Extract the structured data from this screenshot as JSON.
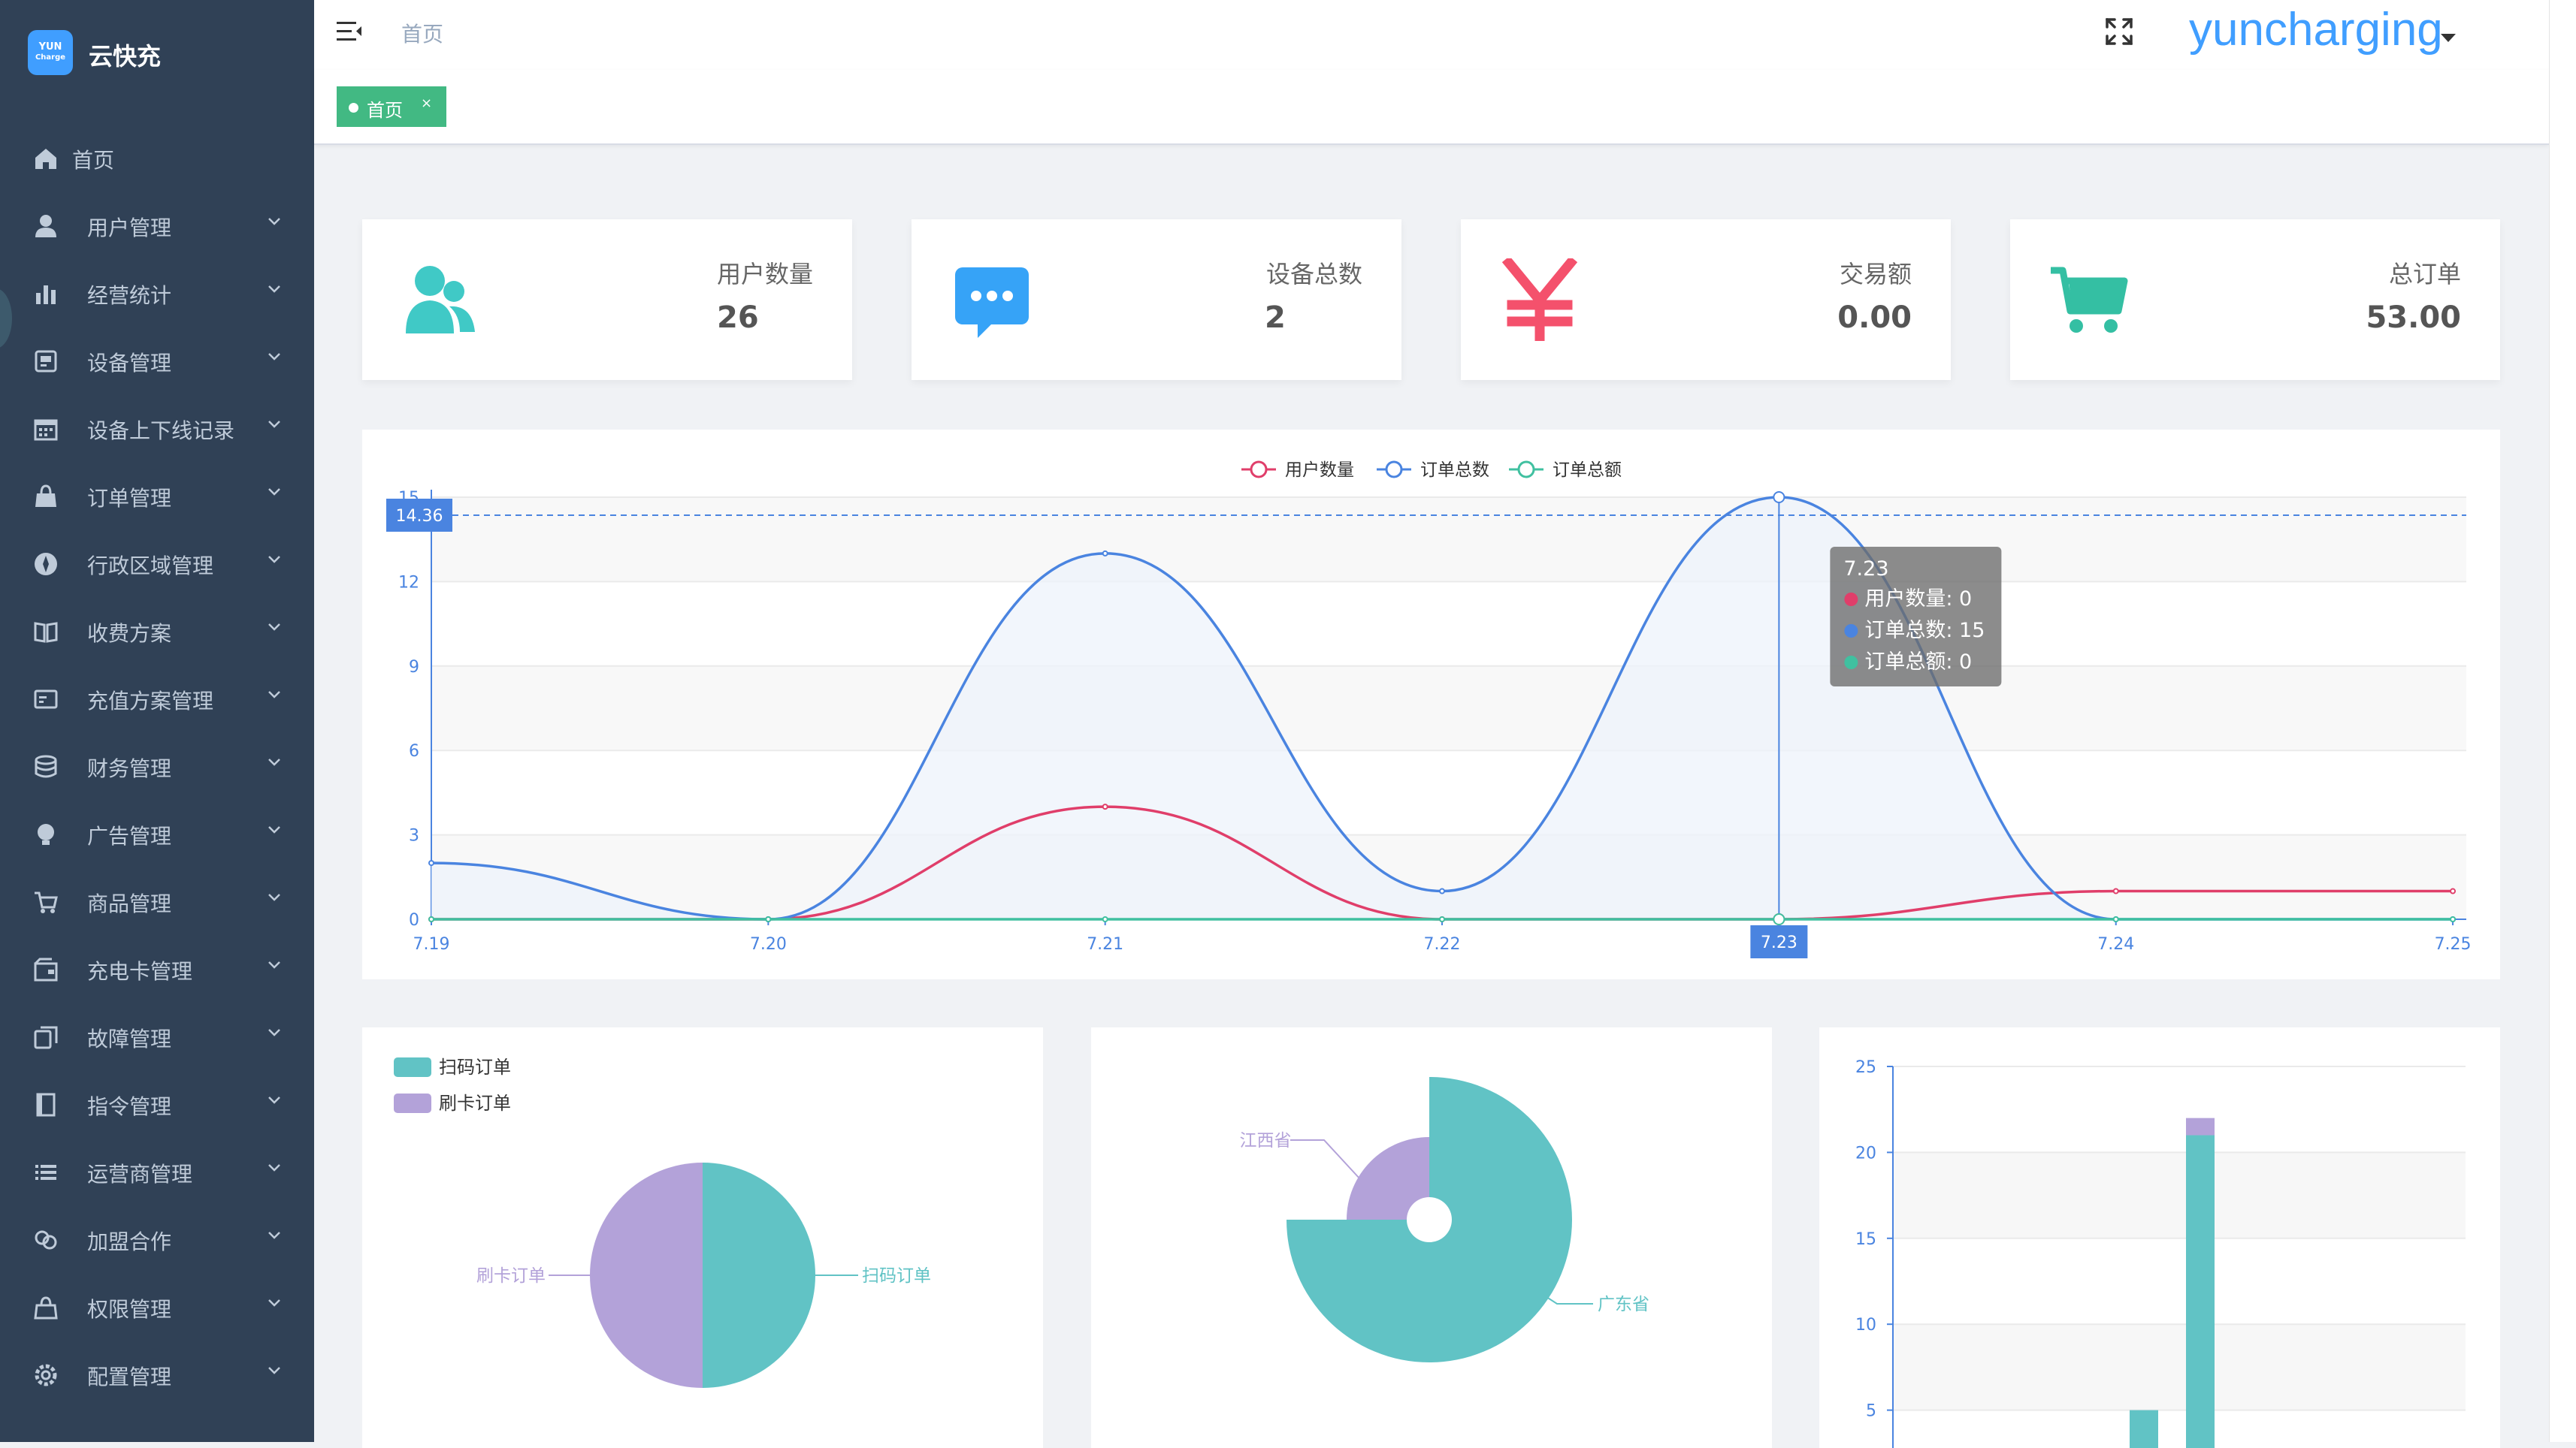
{
  "app": {
    "logo_line1": "YUN",
    "logo_line2": "Charge",
    "title": "云快充"
  },
  "sidebar": {
    "items": [
      {
        "label": "首页",
        "icon": "home-icon"
      },
      {
        "label": "用户管理",
        "icon": "user-icon"
      },
      {
        "label": "经营统计",
        "icon": "bar-chart-icon"
      },
      {
        "label": "设备管理",
        "icon": "device-icon"
      },
      {
        "label": "设备上下线记录",
        "icon": "calendar-icon"
      },
      {
        "label": "订单管理",
        "icon": "shopping-bag-icon"
      },
      {
        "label": "行政区域管理",
        "icon": "compass-icon"
      },
      {
        "label": "收费方案",
        "icon": "book-icon"
      },
      {
        "label": "充值方案管理",
        "icon": "card-icon"
      },
      {
        "label": "财务管理",
        "icon": "database-icon"
      },
      {
        "label": "广告管理",
        "icon": "bulb-icon"
      },
      {
        "label": "商品管理",
        "icon": "cart-icon"
      },
      {
        "label": "充电卡管理",
        "icon": "wallet-icon"
      },
      {
        "label": "故障管理",
        "icon": "copy-icon"
      },
      {
        "label": "指令管理",
        "icon": "film-icon"
      },
      {
        "label": "运营商管理",
        "icon": "list-icon"
      },
      {
        "label": "加盟合作",
        "icon": "link-icon"
      },
      {
        "label": "权限管理",
        "icon": "lock-bag-icon"
      },
      {
        "label": "配置管理",
        "icon": "gear-icon"
      }
    ]
  },
  "header": {
    "breadcrumb": "首页",
    "username": "yuncharging"
  },
  "tags": [
    {
      "label": "首页",
      "close": "×"
    }
  ],
  "stats": [
    {
      "label": "用户数量",
      "value": "26",
      "icon": "users-icon",
      "color": "#40c9c6"
    },
    {
      "label": "设备总数",
      "value": "2",
      "icon": "message-icon",
      "color": "#36a3f7"
    },
    {
      "label": "交易额",
      "value": "0.00",
      "icon": "yen-icon",
      "color": "#f4516c"
    },
    {
      "label": "总订单",
      "value": "53.00",
      "icon": "cart-icon",
      "color": "#34bfa3"
    }
  ],
  "chart_data": [
    {
      "type": "line",
      "categories": [
        "7.19",
        "7.20",
        "7.21",
        "7.22",
        "7.23",
        "7.24",
        "7.25"
      ],
      "series": [
        {
          "name": "用户数量",
          "color": "#e03e6a",
          "values": [
            0,
            0,
            4,
            0,
            0,
            1,
            1
          ]
        },
        {
          "name": "订单总数",
          "color": "#4a84e0",
          "values": [
            2,
            0,
            13,
            1,
            15,
            0,
            0
          ]
        },
        {
          "name": "订单总额",
          "color": "#40c0a0",
          "values": [
            0,
            0,
            0,
            0,
            0,
            0,
            0
          ]
        }
      ],
      "ylim": [
        0,
        15
      ],
      "yticks": [
        "0",
        "3",
        "6",
        "9",
        "12",
        "15"
      ],
      "legend_position": "top-center",
      "grid": true,
      "crosshair": {
        "x_label": "7.23",
        "y_label": "14.36"
      },
      "tooltip": {
        "title": "7.23",
        "rows": [
          {
            "text": "用户数量: 0",
            "color": "#e03e6a"
          },
          {
            "text": "订单总数: 15",
            "color": "#4a84e0"
          },
          {
            "text": "订单总额: 0",
            "color": "#40c0a0"
          }
        ]
      }
    },
    {
      "type": "pie",
      "legend": [
        "扫码订单",
        "刷卡订单"
      ],
      "labels": [
        "扫码订单",
        "刷卡订单"
      ],
      "values": [
        1,
        1
      ],
      "colors": [
        "#61c3c5",
        "#b3a2d9"
      ],
      "legend_position": "top-left"
    },
    {
      "type": "pie",
      "variant": "rose",
      "labels": [
        "广东省",
        "江西省"
      ],
      "values": [
        0.75,
        0.25
      ],
      "colors": [
        "#61c3c5",
        "#b3a2d9"
      ]
    },
    {
      "type": "bar",
      "stacked": true,
      "ylim": [
        0,
        25
      ],
      "yticks": [
        "5",
        "10",
        "15",
        "20",
        "25"
      ],
      "series": [
        {
          "color": "#61c3c5",
          "values": [
            5,
            21
          ]
        },
        {
          "color": "#b3a2d9",
          "values": [
            0,
            1
          ]
        }
      ],
      "grid": true
    }
  ]
}
